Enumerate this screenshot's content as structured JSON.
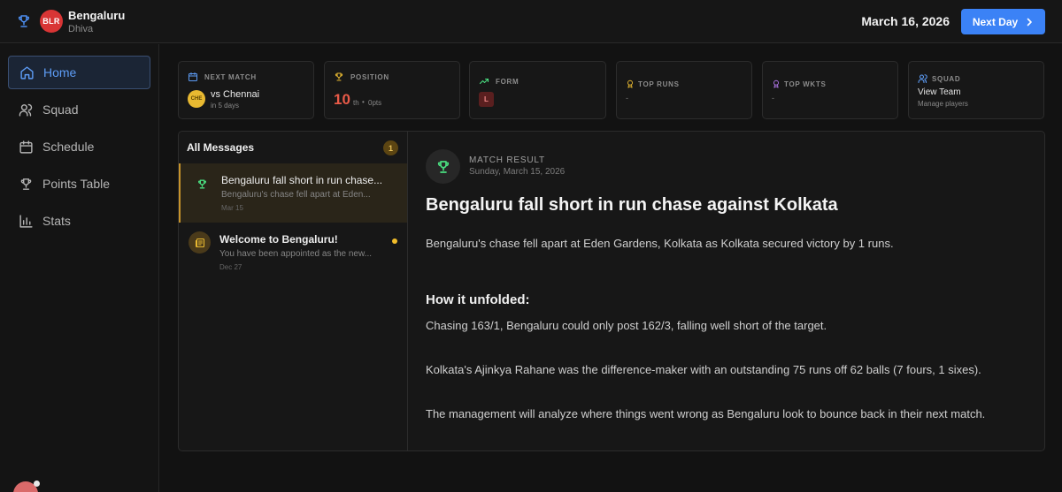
{
  "header": {
    "team_badge": "BLR",
    "team_name": "Bengaluru",
    "manager_name": "Dhiva",
    "date": "March 16, 2026",
    "next_day_label": "Next Day"
  },
  "sidebar": {
    "items": [
      {
        "label": "Home",
        "icon": "home-icon",
        "active": true
      },
      {
        "label": "Squad",
        "icon": "users-icon"
      },
      {
        "label": "Schedule",
        "icon": "calendar-icon"
      },
      {
        "label": "Points Table",
        "icon": "trophy-icon"
      },
      {
        "label": "Stats",
        "icon": "bar-chart-icon"
      }
    ]
  },
  "cards": {
    "next_match": {
      "label": "Next Match",
      "opponent_badge": "CHE",
      "opponent": "vs Chennai",
      "sub": "in 5 days"
    },
    "position": {
      "label": "Position",
      "value": "10",
      "suffix": "th",
      "separator": "•",
      "points": "0pts"
    },
    "form": {
      "label": "Form",
      "results": [
        "L"
      ]
    },
    "top_runs": {
      "label": "Top Runs",
      "value": "-"
    },
    "top_wkts": {
      "label": "Top Wkts",
      "value": "-"
    },
    "squad": {
      "label": "Squad",
      "link": "View Team",
      "sub": "Manage players"
    }
  },
  "colors": {
    "accent": "#3b82f6",
    "position": "#e85a48",
    "selected_message": "#c6932b",
    "unread": "#f2bd2a",
    "form_loss": "#f08a8a"
  },
  "messages": {
    "title": "All Messages",
    "unread_count": "1",
    "items": [
      {
        "title": "Bengaluru fall short in run chase...",
        "preview": "Bengaluru's chase fell apart at Eden...",
        "date": "Mar 15",
        "icon": "trophy-icon",
        "selected": true
      },
      {
        "title": "Welcome to Bengaluru!",
        "preview": "You have been appointed as the new...",
        "date": "Dec 27",
        "icon": "newspaper-icon",
        "unread": true
      }
    ]
  },
  "detail": {
    "kind": "Match Result",
    "date": "Sunday, March 15, 2026",
    "headline": "Bengaluru fall short in run chase against Kolkata",
    "summary": "Bengaluru's chase fell apart at Eden Gardens, Kolkata as Kolkata secured victory by 1 runs.",
    "section_title": "How it unfolded:",
    "paragraphs": [
      "Chasing 163/1, Bengaluru could only post 162/3, falling well short of the target.",
      "Kolkata's Ajinkya Rahane was the difference-maker with an outstanding 75 runs off 62 balls (7 fours, 1 sixes).",
      "The management will analyze where things went wrong as Bengaluru look to bounce back in their next match."
    ]
  }
}
